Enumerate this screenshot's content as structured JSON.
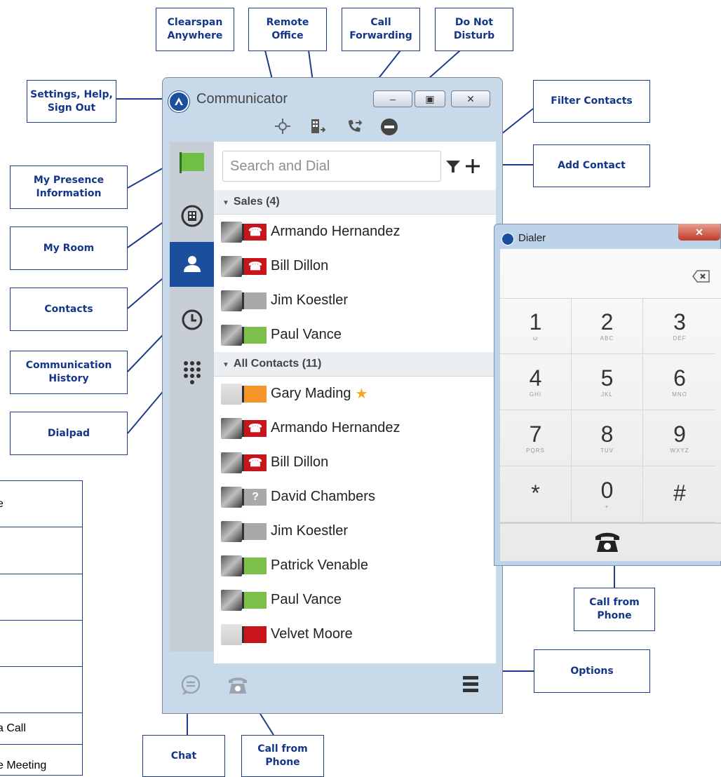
{
  "window": {
    "title": "Communicator",
    "minimize": "–",
    "maximize": "▣",
    "close": "✕"
  },
  "toolbar_icons": [
    "clearspan-anywhere-icon",
    "remote-office-icon",
    "call-forwarding-icon",
    "do-not-disturb-icon"
  ],
  "search": {
    "placeholder": "Search and Dial"
  },
  "groups": [
    {
      "label": "Sales (4)",
      "contacts": [
        {
          "name": "Armando Hernandez",
          "presence": "busy-phone"
        },
        {
          "name": "Bill Dillon",
          "presence": "busy-phone"
        },
        {
          "name": "Jim Koestler",
          "presence": "offline"
        },
        {
          "name": "Paul Vance",
          "presence": "available"
        }
      ]
    },
    {
      "label": "All Contacts (11)",
      "contacts": [
        {
          "name": "Gary Mading",
          "presence": "away",
          "favorite": true
        },
        {
          "name": "Armando Hernandez",
          "presence": "busy-phone"
        },
        {
          "name": "Bill Dillon",
          "presence": "busy-phone"
        },
        {
          "name": "David Chambers",
          "presence": "unknown"
        },
        {
          "name": "Jim Koestler",
          "presence": "offline"
        },
        {
          "name": "Patrick Venable",
          "presence": "available"
        },
        {
          "name": "Paul Vance",
          "presence": "available"
        },
        {
          "name": "Velvet Moore",
          "presence": "busy"
        }
      ]
    }
  ],
  "favorite_glyph": "★",
  "presence_colors": {
    "busy": "#c8151b",
    "available": "#7cc04b",
    "away": "#f5962a",
    "offline": "#a7a9ab",
    "unknown": "#a7a9ab"
  },
  "dialer": {
    "title": "Dialer",
    "keys": [
      {
        "digit": "1",
        "letters": "ω"
      },
      {
        "digit": "2",
        "letters": "ABC"
      },
      {
        "digit": "3",
        "letters": "DEF"
      },
      {
        "digit": "4",
        "letters": "GHI"
      },
      {
        "digit": "5",
        "letters": "JKL"
      },
      {
        "digit": "6",
        "letters": "MNO"
      },
      {
        "digit": "7",
        "letters": "PQRS"
      },
      {
        "digit": "8",
        "letters": "TUV"
      },
      {
        "digit": "9",
        "letters": "WXYZ"
      },
      {
        "digit": "*",
        "letters": ""
      },
      {
        "digit": "0",
        "letters": "+"
      },
      {
        "digit": "#",
        "letters": ""
      }
    ]
  },
  "callouts": {
    "clearspan": "Clearspan\nAnywhere",
    "remote_office": "Remote\nOffice",
    "call_forwarding": "Call\nForwarding",
    "dnd": "Do Not\nDisturb",
    "settings": "Settings, Help,\nSign Out",
    "filter": "Filter Contacts",
    "add_contact": "Add Contact",
    "presence": "My Presence\nInformation",
    "my_room": "My Room",
    "contacts": "Contacts",
    "history": "Communication\nHistory",
    "dialpad": "Dialpad",
    "call_from_phone_dialer": "Call from\nPhone",
    "options": "Options",
    "chat": "Chat",
    "call_from_phone_bottom": "Call from\nPhone"
  },
  "side_table": [
    "e",
    "",
    "",
    "",
    "",
    "a Call",
    "e Meeting"
  ],
  "accent": "#14368a"
}
